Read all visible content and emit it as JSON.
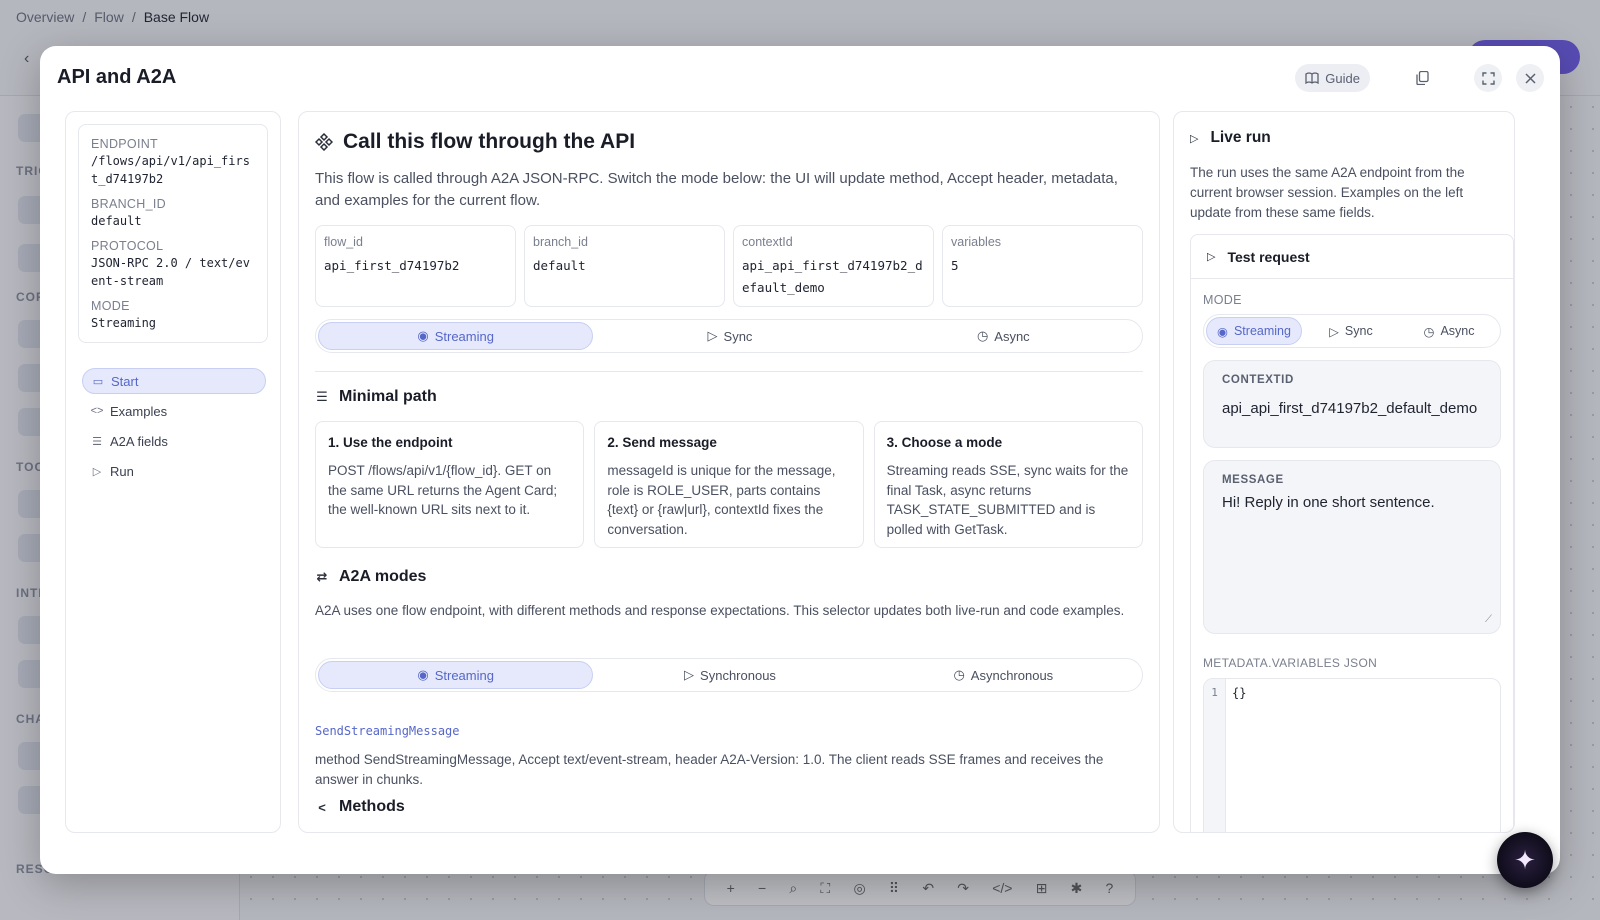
{
  "background": {
    "breadcrumb": [
      "Overview",
      "Flow",
      "Base Flow"
    ],
    "sidebar_sections": [
      "TRIG",
      "COR",
      "TOO",
      "INTI",
      "CHA"
    ],
    "resources_label": "RESOURCES",
    "resources_help": "?"
  },
  "modal": {
    "title": "API and A2A",
    "guide_label": "Guide",
    "icons": [
      "book-icon",
      "copy-icon",
      "expand-icon",
      "close-icon"
    ]
  },
  "sidebar": {
    "fields": [
      {
        "label": "ENDPOINT",
        "value": "/flows/api/v1/api_first_d74197b2"
      },
      {
        "label": "BRANCH_ID",
        "value": "default"
      },
      {
        "label": "PROTOCOL",
        "value": "JSON-RPC 2.0 / text/event-stream"
      },
      {
        "label": "MODE",
        "value": "Streaming"
      }
    ],
    "nav": [
      {
        "label": "Start",
        "icon": "book-icon",
        "active": true
      },
      {
        "label": "Examples",
        "icon": "code-icon",
        "active": false
      },
      {
        "label": "A2A fields",
        "icon": "list-icon",
        "active": false
      },
      {
        "label": "Run",
        "icon": "play-icon",
        "active": false
      }
    ]
  },
  "main": {
    "title": "Call this flow through the API",
    "lead": "This flow is called through A2A JSON-RPC. Switch the mode below: the UI will update method, Accept header, metadata, and examples for the current flow.",
    "stats": [
      {
        "label": "flow_id",
        "value": "api_first_d74197b2"
      },
      {
        "label": "branch_id",
        "value": "default"
      },
      {
        "label": "contextId",
        "value": "api_api_first_d74197b2_default_demo"
      },
      {
        "label": "variables",
        "value": "5"
      }
    ],
    "mode_tabs": [
      "Streaming",
      "Sync",
      "Async"
    ],
    "minimal_path_title": "Minimal path",
    "steps": [
      {
        "title": "1. Use the endpoint",
        "text": "POST /flows/api/v1/{flow_id}. GET on the same URL returns the Agent Card; the well-known URL sits next to it."
      },
      {
        "title": "2. Send message",
        "text": "messageId is unique for the message, role is ROLE_USER, parts contains {text} or {raw|url}, contextId fixes the conversation."
      },
      {
        "title": "3. Choose a mode",
        "text": "Streaming reads SSE, sync waits for the final Task, async returns TASK_STATE_SUBMITTED and is polled with GetTask."
      }
    ],
    "a2a_modes_title": "A2A modes",
    "a2a_modes_text": "A2A uses one flow endpoint, with different methods and response expectations. This selector updates both live-run and code examples.",
    "a2a_tabs": [
      "Streaming",
      "Synchronous",
      "Asynchronous"
    ],
    "method_name": "SendStreamingMessage",
    "method_text": "method SendStreamingMessage, Accept text/event-stream, header A2A-Version: 1.0. The client reads SSE frames and receives the answer in chunks.",
    "methods_title": "Methods"
  },
  "live_run": {
    "title": "Live run",
    "desc": "The run uses the same A2A endpoint from the current browser session. Examples on the left update from these same fields.",
    "test_title": "Test request",
    "mode_label": "MODE",
    "mode_tabs": [
      "Streaming",
      "Sync",
      "Async"
    ],
    "context_label": "CONTEXTID",
    "context_value": "api_api_first_d74197b2_default_demo",
    "message_label": "MESSAGE",
    "message_value": "Hi! Reply in one short sentence.",
    "metadata_label": "METADATA.VARIABLES JSON",
    "editor_line": "1",
    "editor_code": "{}"
  },
  "toolbar_icons": [
    "+",
    "−",
    "⌕",
    "⛶",
    "◎",
    "⠿",
    "↶",
    "↷",
    "</>",
    "⊞",
    "✱",
    "?"
  ],
  "colors": {
    "accent": "#5667c8",
    "accent_bg": "#e5e9fb",
    "publish": "#6d5be8"
  }
}
